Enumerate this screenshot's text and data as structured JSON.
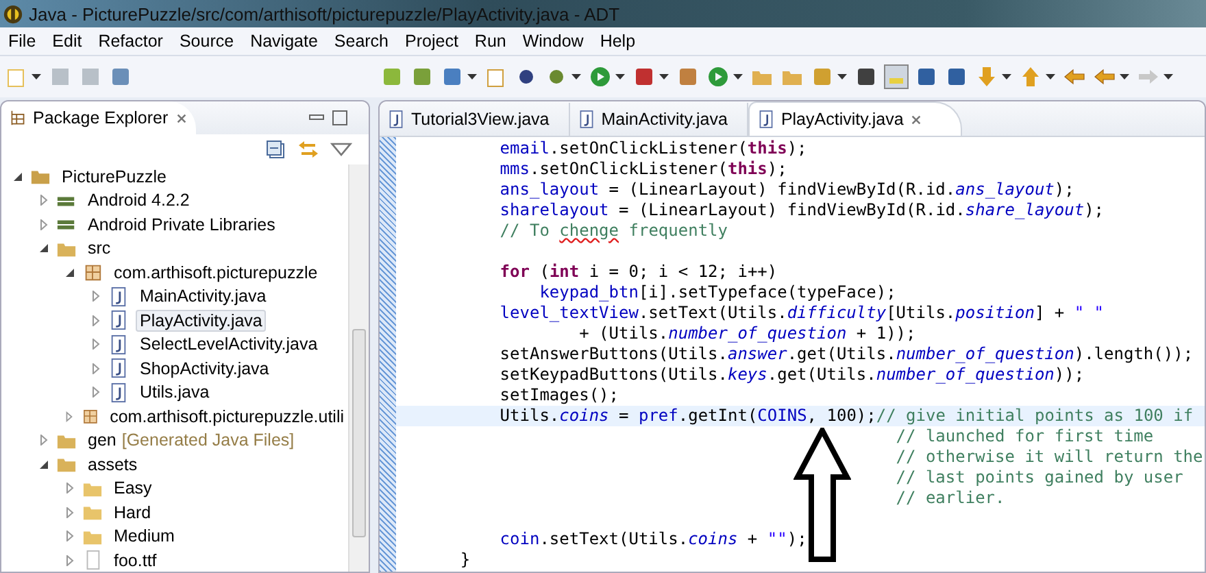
{
  "window": {
    "title": "Java - PicturePuzzle/src/com/arthisoft/picturepuzzle/PlayActivity.java - ADT"
  },
  "menu": [
    "File",
    "Edit",
    "Refactor",
    "Source",
    "Navigate",
    "Search",
    "Project",
    "Run",
    "Window",
    "Help"
  ],
  "package_explorer": {
    "title": "Package Explorer",
    "tree": [
      {
        "name": "PicturePuzzle",
        "kind": "project",
        "expanded": true,
        "selected": false,
        "children": [
          {
            "name": "Android 4.2.2",
            "kind": "library",
            "expanded": false,
            "selected": false
          },
          {
            "name": "Android Private Libraries",
            "kind": "library",
            "expanded": false,
            "selected": false
          },
          {
            "name": "src",
            "kind": "srcfolder",
            "expanded": true,
            "selected": false,
            "children": [
              {
                "name": "com.arthisoft.picturepuzzle",
                "kind": "package",
                "expanded": true,
                "selected": false,
                "children": [
                  {
                    "name": "MainActivity.java",
                    "kind": "java",
                    "expanded": false,
                    "selected": false
                  },
                  {
                    "name": "PlayActivity.java",
                    "kind": "java",
                    "expanded": false,
                    "selected": true
                  },
                  {
                    "name": "SelectLevelActivity.java",
                    "kind": "java",
                    "expanded": false,
                    "selected": false
                  },
                  {
                    "name": "ShopActivity.java",
                    "kind": "java",
                    "expanded": false,
                    "selected": false
                  },
                  {
                    "name": "Utils.java",
                    "kind": "java",
                    "expanded": false,
                    "selected": false
                  }
                ]
              },
              {
                "name": "com.arthisoft.picturepuzzle.utili",
                "kind": "package",
                "expanded": false,
                "selected": false
              }
            ]
          },
          {
            "name": "gen",
            "decoration": "[Generated Java Files]",
            "kind": "srcfolder",
            "expanded": false,
            "selected": false
          },
          {
            "name": "assets",
            "kind": "srcfolder",
            "expanded": true,
            "selected": false,
            "children": [
              {
                "name": "Easy",
                "kind": "folder",
                "expanded": false,
                "selected": false
              },
              {
                "name": "Hard",
                "kind": "folder",
                "expanded": false,
                "selected": false
              },
              {
                "name": "Medium",
                "kind": "folder",
                "expanded": false,
                "selected": false
              },
              {
                "name": "foo.ttf",
                "kind": "file",
                "expanded": false,
                "selected": false
              }
            ]
          }
        ]
      }
    ]
  },
  "editor_tabs": [
    {
      "label": "Tutorial3View.java",
      "selected": false
    },
    {
      "label": "MainActivity.java",
      "selected": false
    },
    {
      "label": "PlayActivity.java",
      "selected": true
    }
  ],
  "code_lines": [
    {
      "kind": "code",
      "current": false,
      "tokens": [
        {
          "text": "        email",
          "kind": "field"
        },
        {
          "text": ".setOnClickListener(",
          "kind": "plain"
        },
        {
          "text": "this",
          "kind": "keyword"
        },
        {
          "text": ");",
          "kind": "plain"
        }
      ]
    },
    {
      "kind": "code",
      "current": false,
      "tokens": [
        {
          "text": "        mms",
          "kind": "field"
        },
        {
          "text": ".setOnClickListener(",
          "kind": "plain"
        },
        {
          "text": "this",
          "kind": "keyword"
        },
        {
          "text": ");",
          "kind": "plain"
        }
      ]
    },
    {
      "kind": "code",
      "current": false,
      "tokens": [
        {
          "text": "        ans_layout",
          "kind": "field"
        },
        {
          "text": " = (LinearLayout) findViewById(R.id.",
          "kind": "plain"
        },
        {
          "text": "ans_layout",
          "kind": "static"
        },
        {
          "text": ");",
          "kind": "plain"
        }
      ]
    },
    {
      "kind": "code",
      "current": false,
      "tokens": [
        {
          "text": "        sharelayout",
          "kind": "field"
        },
        {
          "text": " = (LinearLayout) findViewById(R.id.",
          "kind": "plain"
        },
        {
          "text": "share_layout",
          "kind": "static"
        },
        {
          "text": ");",
          "kind": "plain"
        }
      ]
    },
    {
      "kind": "code",
      "current": false,
      "tokens": [
        {
          "text": "        // To ",
          "kind": "comment"
        },
        {
          "text": "chenge",
          "kind": "typo"
        },
        {
          "text": " frequently",
          "kind": "comment"
        }
      ]
    },
    {
      "kind": "blank",
      "current": false
    },
    {
      "kind": "code",
      "current": false,
      "tokens": [
        {
          "text": "        for",
          "kind": "keyword"
        },
        {
          "text": " (",
          "kind": "plain"
        },
        {
          "text": "int",
          "kind": "keyword"
        },
        {
          "text": " i = 0; i < 12; i++)",
          "kind": "plain"
        }
      ]
    },
    {
      "kind": "code",
      "current": false,
      "tokens": [
        {
          "text": "            keypad_btn",
          "kind": "field"
        },
        {
          "text": "[i].setTypeface(typeFace);",
          "kind": "plain"
        }
      ]
    },
    {
      "kind": "code",
      "current": false,
      "tokens": [
        {
          "text": "        level_textView",
          "kind": "field"
        },
        {
          "text": ".setText(Utils.",
          "kind": "plain"
        },
        {
          "text": "difficulty",
          "kind": "static"
        },
        {
          "text": "[Utils.",
          "kind": "plain"
        },
        {
          "text": "position",
          "kind": "static"
        },
        {
          "text": "] + ",
          "kind": "plain"
        },
        {
          "text": "\" \"",
          "kind": "string"
        }
      ]
    },
    {
      "kind": "code",
      "current": false,
      "tokens": [
        {
          "text": "                + (Utils.",
          "kind": "plain"
        },
        {
          "text": "number_of_question",
          "kind": "static"
        },
        {
          "text": " + 1));",
          "kind": "plain"
        }
      ]
    },
    {
      "kind": "code",
      "current": false,
      "tokens": [
        {
          "text": "        setAnswerButtons(Utils.",
          "kind": "plain"
        },
        {
          "text": "answer",
          "kind": "static"
        },
        {
          "text": ".get(Utils.",
          "kind": "plain"
        },
        {
          "text": "number_of_question",
          "kind": "static"
        },
        {
          "text": ").length());",
          "kind": "plain"
        }
      ]
    },
    {
      "kind": "code",
      "current": false,
      "tokens": [
        {
          "text": "        setKeypadButtons(Utils.",
          "kind": "plain"
        },
        {
          "text": "keys",
          "kind": "static"
        },
        {
          "text": ".get(Utils.",
          "kind": "plain"
        },
        {
          "text": "number_of_question",
          "kind": "static"
        },
        {
          "text": "));",
          "kind": "plain"
        }
      ]
    },
    {
      "kind": "code",
      "current": false,
      "tokens": [
        {
          "text": "        setImages();",
          "kind": "plain"
        }
      ]
    },
    {
      "kind": "code",
      "current": true,
      "tokens": [
        {
          "text": "        Utils.",
          "kind": "plain"
        },
        {
          "text": "coins",
          "kind": "static"
        },
        {
          "text": " = ",
          "kind": "plain"
        },
        {
          "text": "pref",
          "kind": "field"
        },
        {
          "text": ".getInt(",
          "kind": "plain"
        },
        {
          "text": "COINS",
          "kind": "field"
        },
        {
          "text": ", 100);",
          "kind": "plain"
        },
        {
          "text": "// give initial points as 100 if",
          "kind": "comment"
        }
      ]
    },
    {
      "kind": "code",
      "current": false,
      "tokens": [
        {
          "text": "                                                // launched for first time",
          "kind": "comment"
        }
      ]
    },
    {
      "kind": "code",
      "current": false,
      "tokens": [
        {
          "text": "                                                // otherwise it will return the",
          "kind": "comment"
        }
      ]
    },
    {
      "kind": "code",
      "current": false,
      "tokens": [
        {
          "text": "                                                // last points gained by user",
          "kind": "comment"
        }
      ]
    },
    {
      "kind": "code",
      "current": false,
      "tokens": [
        {
          "text": "                                                // earlier.",
          "kind": "comment"
        }
      ]
    },
    {
      "kind": "blank",
      "current": false
    },
    {
      "kind": "code",
      "current": false,
      "tokens": [
        {
          "text": "        coin",
          "kind": "field"
        },
        {
          "text": ".setText(Utils.",
          "kind": "plain"
        },
        {
          "text": "coins",
          "kind": "static"
        },
        {
          "text": " + ",
          "kind": "plain"
        },
        {
          "text": "\"\"",
          "kind": "string"
        },
        {
          "text": ");",
          "kind": "plain"
        }
      ]
    },
    {
      "kind": "code",
      "current": false,
      "tokens": [
        {
          "text": "    }",
          "kind": "plain"
        }
      ]
    }
  ]
}
